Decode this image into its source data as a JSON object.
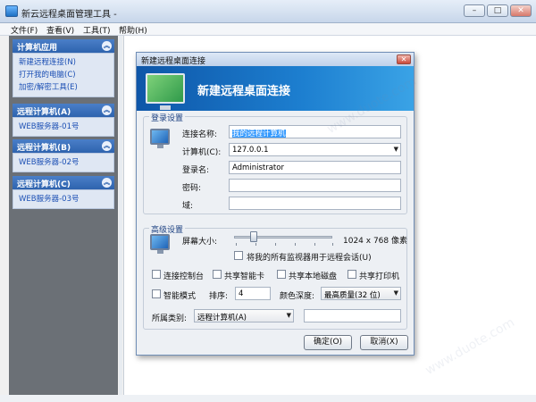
{
  "window": {
    "title": "新云远程桌面管理工具 -",
    "min_glyph": "–",
    "max_glyph": "□",
    "close_glyph": "✕"
  },
  "menubar": [
    "文件(F)",
    "查看(V)",
    "工具(T)",
    "帮助(H)"
  ],
  "sidebar": {
    "groups": [
      {
        "header": "计算机应用",
        "items": [
          "新建远程连接(N)",
          "打开我的电脑(C)",
          "加密/解密工具(E)"
        ]
      },
      {
        "header": "远程计算机(A)",
        "items": [
          "WEB服务器-01号"
        ]
      },
      {
        "header": "远程计算机(B)",
        "items": [
          "WEB服务器-02号"
        ]
      },
      {
        "header": "远程计算机(C)",
        "items": [
          "WEB服务器-03号"
        ]
      }
    ],
    "collapse_glyph": "︽"
  },
  "dialog": {
    "title": "新建远程桌面连接",
    "close_glyph": "✕",
    "banner_title": "新建远程桌面连接",
    "login": {
      "legend": "登录设置",
      "name_label": "连接名称:",
      "name_value": "我的远程计算机",
      "computer_label": "计算机(C):",
      "computer_value": "127.0.0.1",
      "user_label": "登录名:",
      "user_value": "Administrator",
      "password_label": "密码:",
      "password_value": "",
      "domain_label": "域:",
      "domain_value": ""
    },
    "advanced": {
      "legend": "高级设置",
      "screen_label": "屏幕大小:",
      "screen_value": "1024 x 768 像素",
      "screen_slider_fraction": 0.2,
      "all_monitors_label": "将我的所有监视器用于远程会话(U)",
      "all_monitors_checked": false,
      "console_label": "连接控制台",
      "console_checked": false,
      "smartcard_label": "共享智能卡",
      "smartcard_checked": false,
      "disk_label": "共享本地磁盘",
      "disk_checked": false,
      "printer_label": "共享打印机",
      "printer_checked": false,
      "smart_mode_label": "智能模式",
      "smart_mode_checked": false,
      "order_label": "排序:",
      "order_value": "4",
      "color_label": "颜色深度:",
      "color_value": "最高质量(32 位)",
      "category_label": "所属类别:",
      "category_value": "远程计算机(A)",
      "extra_value": ""
    },
    "ok_label": "确定(O)",
    "cancel_label": "取消(X)"
  },
  "colors": {
    "banner": "#1d7fd0",
    "sidebar_header": "#2e63ae",
    "link": "#1b4fb4"
  }
}
